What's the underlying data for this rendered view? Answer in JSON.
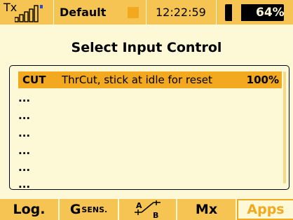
{
  "status": {
    "tx_label": "Tx",
    "signal_bars_filled": 5,
    "model_name": "Default",
    "time": "12:22:59",
    "battery_percent_text": "64%",
    "battery_level": 0.64,
    "colors": {
      "accent": "#f6c453",
      "highlight": "#f2a81f",
      "background": "#fdf8d6",
      "link_indicator": "#2a4bd7"
    }
  },
  "title": "Select Input Control",
  "list": {
    "selected": {
      "name": "CUT",
      "description": "ThrCut, stick at idle for reset",
      "value": "100%"
    },
    "empty_rows": [
      "...",
      "...",
      "...",
      "...",
      "...",
      "..."
    ]
  },
  "tabs": {
    "log": "Log.",
    "gsens_main": "G",
    "gsens_sub": "SENS.",
    "ab_a": "A",
    "ab_b": "B",
    "mx": "Mx",
    "apps": "Apps"
  }
}
